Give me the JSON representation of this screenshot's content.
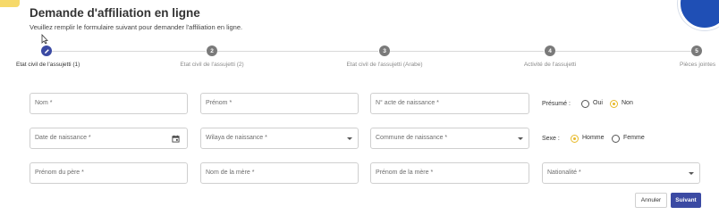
{
  "header": {
    "title": "Demande d'affiliation en ligne",
    "subtitle": "Veuillez remplir le formulaire suivant pour demander l'affiliation en ligne."
  },
  "stepper": {
    "steps": [
      {
        "number": "1",
        "label": "Etat civil de l'assujetti (1)",
        "active": true,
        "icon": "pencil-icon"
      },
      {
        "number": "2",
        "label": "Etat civil de l'assujetti (2)"
      },
      {
        "number": "3",
        "label": "Etat civil de l'assujetti (Arabe)"
      },
      {
        "number": "4",
        "label": "Activité de l'assujetti"
      },
      {
        "number": "5",
        "label": "Pièces jointes"
      }
    ]
  },
  "form": {
    "nom": "Nom *",
    "prenom": "Prénom *",
    "acte": "N° acte de naissance *",
    "presume_label": "Présumé :",
    "presume_options": [
      "Oui",
      "Non"
    ],
    "presume_selected": "Non",
    "date_naissance": "Date de naissance *",
    "wilaya": "Wilaya de naissance *",
    "commune": "Commune de naissance *",
    "sexe_label": "Sexe :",
    "sexe_options": [
      "Homme",
      "Femme"
    ],
    "sexe_selected": "Homme",
    "prenom_pere": "Prénom du père *",
    "nom_mere": "Nom de la mère *",
    "prenom_mere": "Prénom de la mère *",
    "nationalite": "Nationalité *"
  },
  "actions": {
    "cancel": "Annuler",
    "next": "Suivant"
  },
  "colors": {
    "accent": "#3b4aa3",
    "radio_selected": "#e7b928",
    "brand_circle": "#1f4fb5"
  }
}
